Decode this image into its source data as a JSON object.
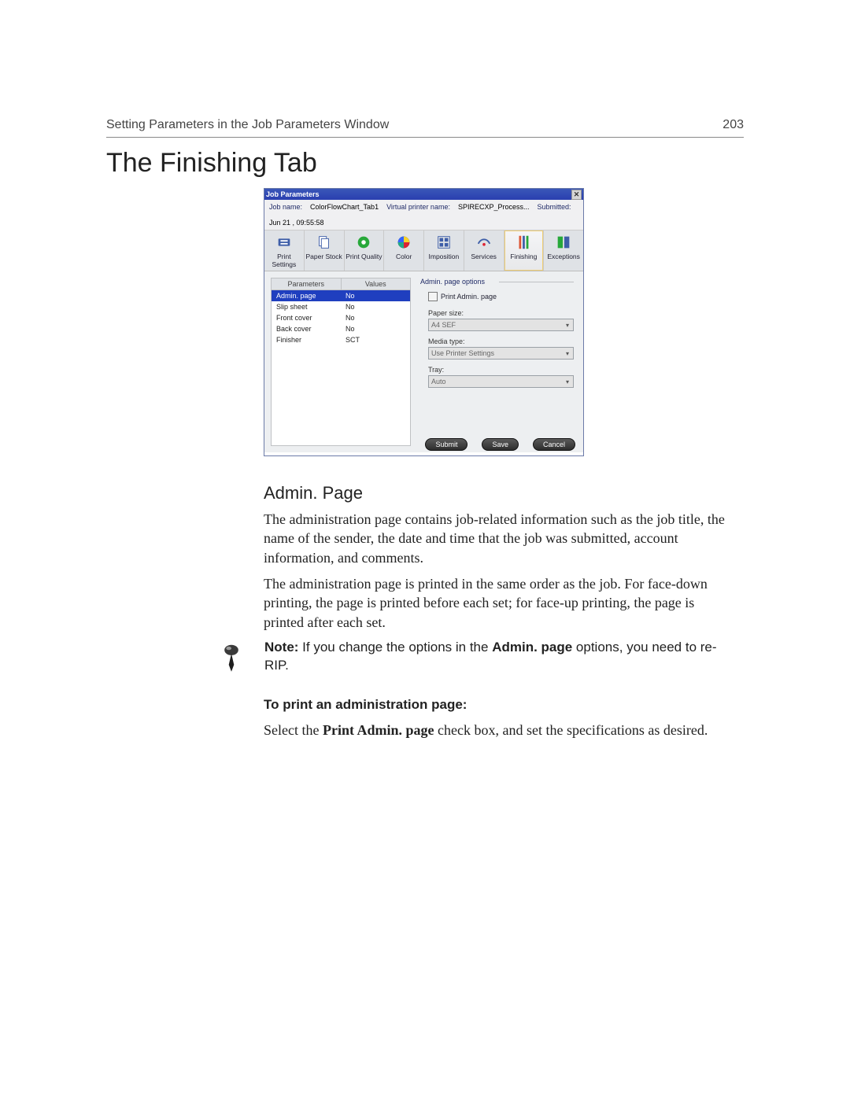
{
  "header": {
    "section_title": "Setting Parameters in the Job Parameters Window",
    "page_number": "203"
  },
  "h1": "The Finishing Tab",
  "app": {
    "title": "Job Parameters",
    "close_glyph": "✕",
    "info": {
      "job_name_label": "Job name:",
      "job_name_value": "ColorFlowChart_Tab1",
      "vpn_label": "Virtual printer name:",
      "vpn_value": "SPIRECXP_Process...",
      "submitted_label": "Submitted:",
      "submitted_value": "Jun 21 , 09:55:58"
    },
    "tabs": [
      "Print Settings",
      "Paper Stock",
      "Print Quality",
      "Color",
      "Imposition",
      "Services",
      "Finishing",
      "Exceptions"
    ],
    "active_tab_index": 6,
    "param_table": {
      "col_parameters": "Parameters",
      "col_values": "Values",
      "rows": [
        {
          "p": "Admin. page",
          "v": "No"
        },
        {
          "p": "Slip sheet",
          "v": "No"
        },
        {
          "p": "Front cover",
          "v": "No"
        },
        {
          "p": "Back cover",
          "v": "No"
        },
        {
          "p": "Finisher",
          "v": "SCT"
        }
      ],
      "selected_index": 0
    },
    "options": {
      "legend": "Admin. page options",
      "checkbox_label": "Print Admin. page",
      "paper_size_label": "Paper size:",
      "paper_size_value": "A4 SEF",
      "media_type_label": "Media type:",
      "media_type_value": "Use Printer Settings",
      "tray_label": "Tray:",
      "tray_value": "Auto"
    },
    "buttons": {
      "submit": "Submit",
      "save": "Save",
      "cancel": "Cancel"
    }
  },
  "subhead": "Admin. Page",
  "para1": "The administration page contains job-related information such as the job title, the name of the sender, the date and time that the job was submitted, account information, and comments.",
  "para2": "The administration page is printed in the same order as the job. For face-down printing, the page is printed before each set; for face-up printing, the page is printed after each set.",
  "note_prefix": "Note:",
  "note_mid1": "  If you change the options in the ",
  "note_bold": "Admin. page",
  "note_mid2": " options, you need to re-RIP.",
  "procedure_head": "To print an administration page:",
  "procedure_pre": "Select the ",
  "procedure_bold": "Print Admin. page",
  "procedure_post": " check box, and set the specifications as desired."
}
